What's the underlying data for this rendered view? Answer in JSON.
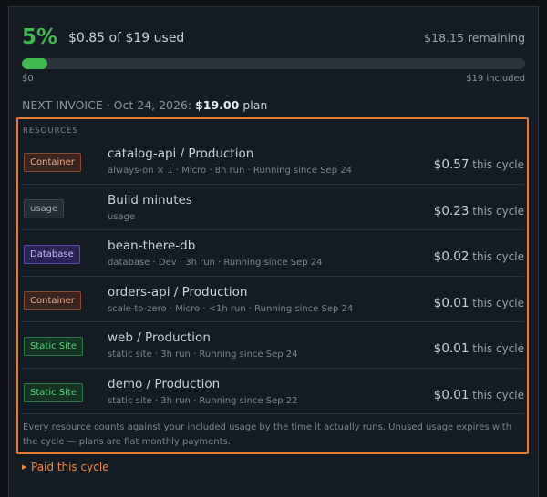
{
  "usage": {
    "percent": "5%",
    "used_text": "$0.85 of $19 used",
    "remaining_text": "$18.15 remaining",
    "progress_fraction": 0.05,
    "bar_min_label": "$0",
    "bar_max_label": "$19 included"
  },
  "invoice": {
    "label": "NEXT INVOICE",
    "separator": " · ",
    "date": "Oct 24, 2026",
    "colon": ": ",
    "amount": "$19.00",
    "plan": " plan"
  },
  "resources": {
    "title": "RESOURCES",
    "items": [
      {
        "badge": "Container",
        "kind": "container",
        "name": "catalog-api / Production",
        "meta": "always-on × 1 · Micro · 8h run · Running since Sep 24",
        "cost": "$0.57",
        "suffix": " this cycle"
      },
      {
        "badge": "usage",
        "kind": "usage",
        "name": "Build minutes",
        "meta": "usage",
        "cost": "$0.23",
        "suffix": " this cycle"
      },
      {
        "badge": "Database",
        "kind": "database",
        "name": "bean-there-db",
        "meta": "database · Dev · 3h run · Running since Sep 24",
        "cost": "$0.02",
        "suffix": " this cycle"
      },
      {
        "badge": "Container",
        "kind": "container",
        "name": "orders-api / Production",
        "meta": "scale-to-zero · Micro · <1h run · Running since Sep 24",
        "cost": "$0.01",
        "suffix": " this cycle"
      },
      {
        "badge": "Static Site",
        "kind": "static",
        "name": "web / Production",
        "meta": "static site · 3h run · Running since Sep 24",
        "cost": "$0.01",
        "suffix": " this cycle"
      },
      {
        "badge": "Static Site",
        "kind": "static",
        "name": "demo / Production",
        "meta": "static site · 3h run · Running since Sep 22",
        "cost": "$0.01",
        "suffix": " this cycle"
      }
    ],
    "note": "Every resource counts against your included usage by the time it actually runs. Unused usage expires with the cycle — plans are flat monthly payments."
  },
  "paid": {
    "caret_icon": "caret-right-icon",
    "label": "Paid this cycle"
  },
  "colors": {
    "accent_green": "#3fb950",
    "highlight_orange": "#e8782a"
  }
}
